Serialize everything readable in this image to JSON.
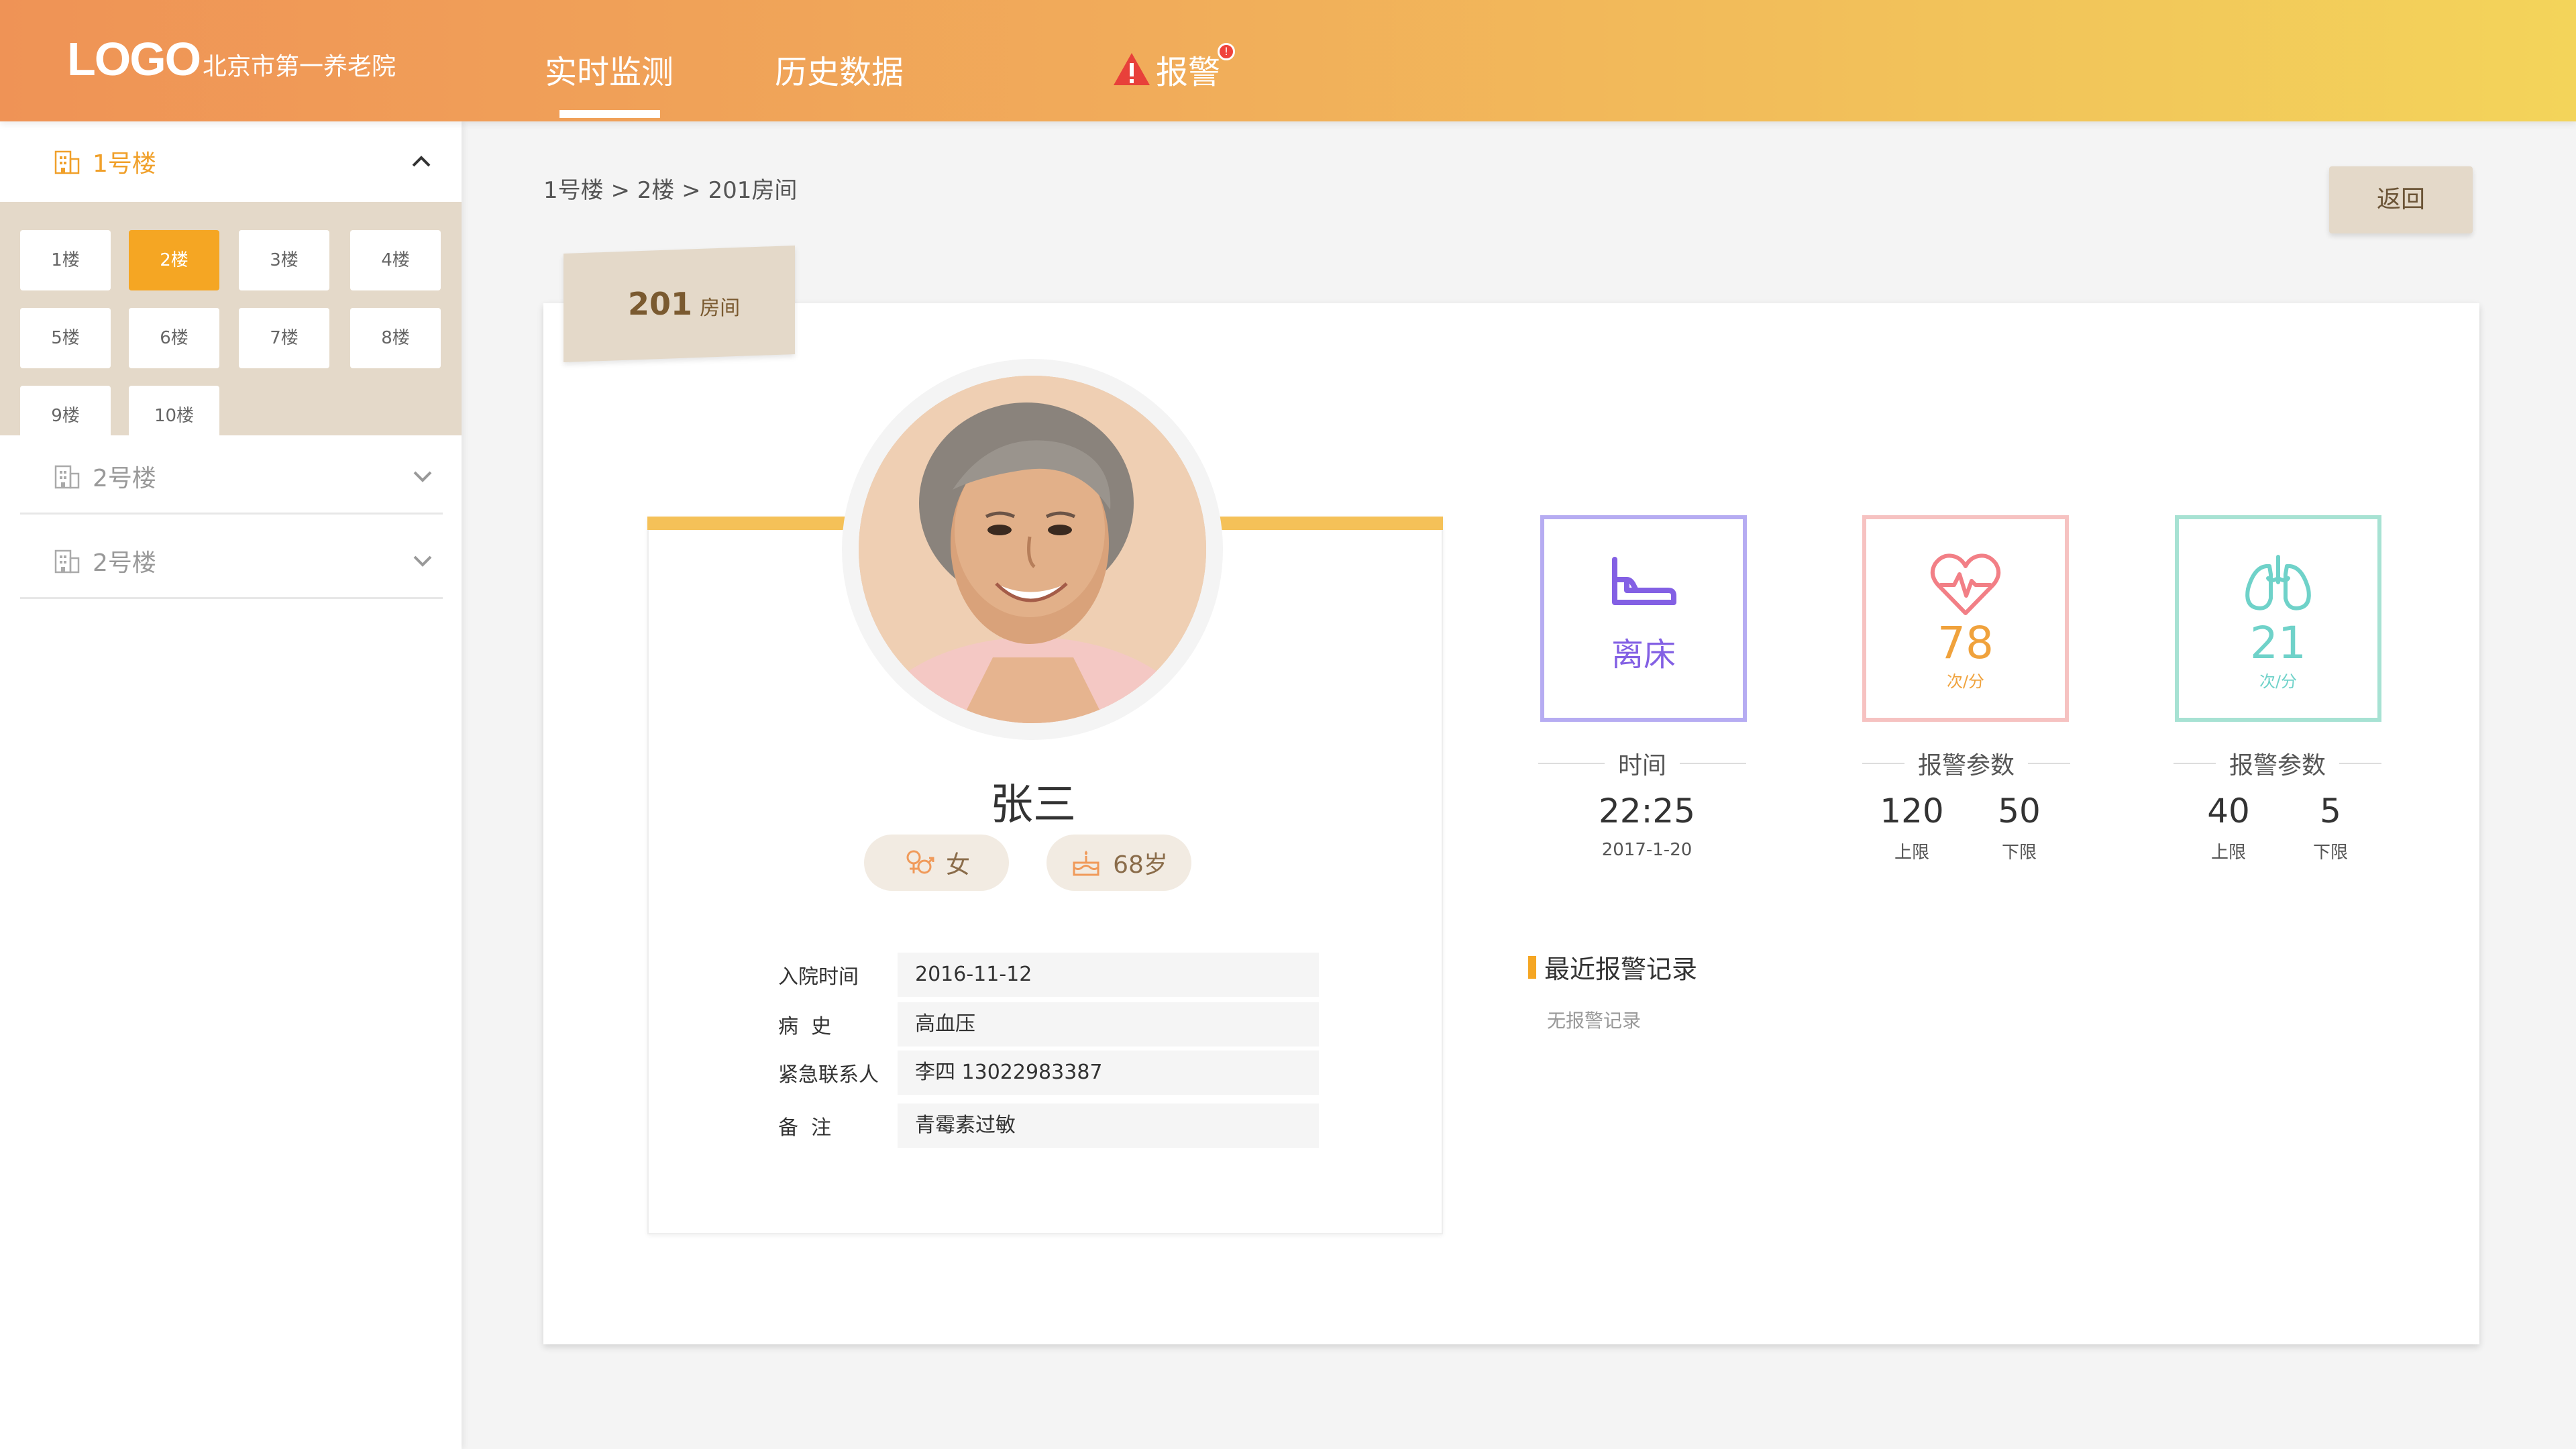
{
  "header": {
    "logo": "LOGO",
    "org_name": "北京市第一养老院",
    "tabs": [
      {
        "label": "实时监测",
        "active": true
      },
      {
        "label": "历史数据",
        "active": false
      },
      {
        "label": "报警",
        "active": false
      }
    ],
    "alarm_badge": "!"
  },
  "sidebar": {
    "buildings": [
      {
        "label": "1号楼",
        "expanded": true
      },
      {
        "label": "2号楼",
        "expanded": false
      },
      {
        "label": "2号楼",
        "expanded": false
      }
    ],
    "floors": [
      "1楼",
      "2楼",
      "3楼",
      "4楼",
      "5楼",
      "6楼",
      "7楼",
      "8楼",
      "9楼",
      "10楼"
    ],
    "active_floor": "2楼"
  },
  "main": {
    "breadcrumb": "1号楼 > 2楼 > 201房间",
    "back_label": "返回",
    "room": {
      "number": "201",
      "unit": "房间"
    },
    "person": {
      "name": "张三",
      "gender": "女",
      "age": "68岁",
      "info": [
        {
          "label": "入院时间",
          "value": "2016-11-12"
        },
        {
          "label": "病  史",
          "value": "高血压"
        },
        {
          "label": "紧急联系人",
          "value": "李四 13022983387"
        },
        {
          "label": "备  注",
          "value": "青霉素过敏"
        }
      ]
    },
    "monitors": {
      "bed": {
        "status": "离床",
        "sub_title": "时间",
        "time": "22:25",
        "date": "2017-1-20"
      },
      "heart": {
        "value": "78",
        "unit": "次/分",
        "sub_title": "报警参数",
        "upper": "120",
        "upper_label": "上限",
        "lower": "50",
        "lower_label": "下限"
      },
      "lung": {
        "value": "21",
        "unit": "次/分",
        "sub_title": "报警参数",
        "upper": "40",
        "upper_label": "上限",
        "lower": "5",
        "lower_label": "下限"
      }
    },
    "alarm_records": {
      "title": "最近报警记录",
      "empty": "无报警记录"
    }
  },
  "colors": {
    "header_gradient_start": "#ef9356",
    "header_gradient_end": "#f3d45a",
    "accent": "#f5a623",
    "panel_beige": "#e4d9c9",
    "bed_purple": "#8360e4",
    "heart_orange": "#f0a23c",
    "lung_teal": "#6fd2c9"
  },
  "icons": [
    "building-icon",
    "chevron-up-icon",
    "chevron-down-icon",
    "warning-icon",
    "bed-icon",
    "heart-pulse-icon",
    "lungs-icon",
    "gender-icon",
    "cake-icon"
  ]
}
